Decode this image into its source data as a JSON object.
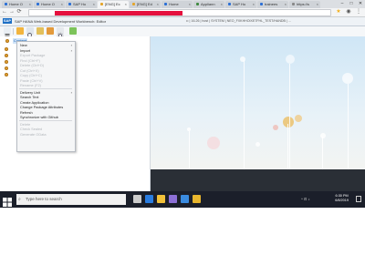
{
  "browser": {
    "tabs": [
      {
        "label": "Home O",
        "color": "#2b6fd6"
      },
      {
        "label": "Home O",
        "color": "#2b6fd6"
      },
      {
        "label": "SAP Ho",
        "color": "#2b6fd6"
      },
      {
        "label": "[ENG] Ec",
        "color": "#e4a42a",
        "active": true
      },
      {
        "label": "[ENG] Ed",
        "color": "#e4a42a"
      },
      {
        "label": "Home",
        "color": "#2b6fd6"
      },
      {
        "label": "Appliann",
        "color": "#3f8a3f"
      },
      {
        "label": "SAP Ho",
        "color": "#2b6fd6"
      },
      {
        "label": "trainees",
        "color": "#2b6fd6"
      },
      {
        "label": "https://s",
        "color": "#888888"
      }
    ],
    "window_controls": [
      "–",
      "□",
      "✕"
    ],
    "nav": {
      "back": "←",
      "forward": "→",
      "reload": "⟳",
      "home": "⌂"
    },
    "accent_redacted_color": "#e5103d"
  },
  "app": {
    "logo_text": "SAP",
    "title": "SAP HANA Web-based Development Workbench: Editor",
    "system_info": "•• | 16.26 | host | SYSTEM | NEO_FXKHHOIXE7FHL_TEST/HANDB | ..."
  },
  "tree": {
    "root_label": "Content"
  },
  "context_menu": {
    "items": [
      {
        "label": "New",
        "disabled": false,
        "submenu": true
      },
      {
        "label": "Import",
        "disabled": false,
        "submenu": true
      },
      {
        "label": "Export Package",
        "disabled": true
      },
      {
        "label": "Find (Ctrl+F)",
        "disabled": true
      },
      {
        "label": "Delete (Ctrl+D)",
        "disabled": true
      },
      {
        "label": "Cut (Ctrl+X)",
        "disabled": true
      },
      {
        "label": "Copy (Ctrl+C)",
        "disabled": true
      },
      {
        "label": "Paste (Ctrl+V)",
        "disabled": true
      },
      {
        "label": "Rename (F2)",
        "disabled": true
      },
      {
        "label": "Delivery Unit",
        "disabled": false,
        "submenu": true
      },
      {
        "label": "Search Text",
        "disabled": false
      },
      {
        "label": "Create Application",
        "disabled": false
      },
      {
        "label": "Change Package Attributes",
        "disabled": false
      },
      {
        "label": "Refresh",
        "disabled": false
      },
      {
        "label": "Synchronize with Github",
        "disabled": false
      },
      {
        "label": "Delete",
        "disabled": true
      },
      {
        "label": "Check Sealed",
        "disabled": true
      },
      {
        "label": "Generate OData",
        "disabled": true
      }
    ]
  },
  "taskbar": {
    "search_placeholder": "Type here to search",
    "time": "6:30 PM",
    "date": "6/8/2019",
    "icons": [
      {
        "name": "task-view-icon",
        "color": "#cccccc"
      },
      {
        "name": "edge-icon",
        "color": "#2a7de1"
      },
      {
        "name": "file-explorer-icon",
        "color": "#f2c13a"
      },
      {
        "name": "store-icon",
        "color": "#8c6fd6"
      },
      {
        "name": "mail-icon",
        "color": "#3a8be0"
      },
      {
        "name": "chrome-icon",
        "color": "#e8b62e"
      }
    ]
  }
}
